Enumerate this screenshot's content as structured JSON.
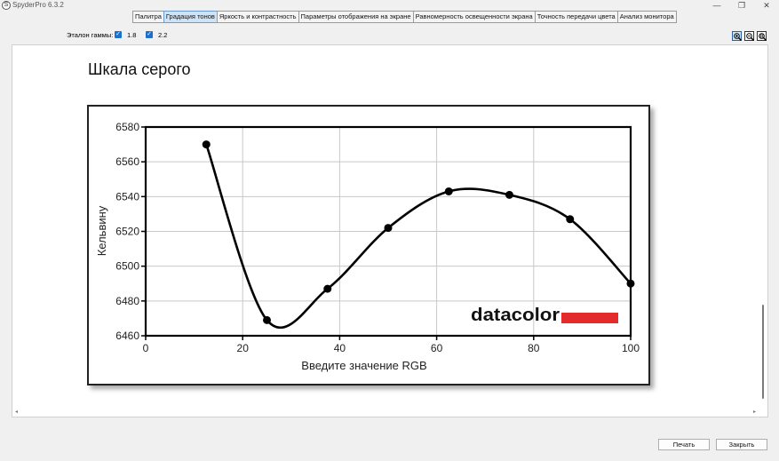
{
  "app": {
    "title": "SpyderPro 6.3.2",
    "icon_glyph": "S"
  },
  "window_controls": {
    "minimize": "—",
    "maximize": "❐",
    "close": "✕"
  },
  "tabs": [
    {
      "label": "Палитра",
      "active": false
    },
    {
      "label": "Градация тонов",
      "active": true
    },
    {
      "label": "Яркость и контрастность",
      "active": false
    },
    {
      "label": "Параметры отображения на экране",
      "active": false
    },
    {
      "label": "Равномерность освещенности экрана",
      "active": false
    },
    {
      "label": "Точность передачи цвета",
      "active": false
    },
    {
      "label": "Анализ монитора",
      "active": false
    }
  ],
  "gamma": {
    "label": "Эталон гаммы:",
    "options": [
      {
        "label": "1.8",
        "checked": true
      },
      {
        "label": "2.2",
        "checked": true
      }
    ]
  },
  "zoom_icons": [
    "zoom-in-icon",
    "zoom-out-icon",
    "zoom-fit-icon"
  ],
  "page": {
    "title": "Шкала серого"
  },
  "chart_data": {
    "type": "line",
    "xlabel": "Введите значение RGB",
    "ylabel": "Кельвину",
    "xlim": [
      0,
      100
    ],
    "ylim": [
      6460,
      6580
    ],
    "x_ticks": [
      0,
      20,
      40,
      60,
      80,
      100
    ],
    "y_ticks": [
      6460,
      6480,
      6500,
      6520,
      6540,
      6560,
      6580
    ],
    "grid": true,
    "series": [
      {
        "x": [
          12.5,
          25,
          37.5,
          50,
          62.5,
          75,
          87.5,
          100
        ],
        "y": [
          6570,
          6469,
          6487,
          6522,
          6543,
          6541,
          6527,
          6490
        ]
      }
    ],
    "logo": "datacolor",
    "colors": {
      "line": "#000000",
      "grid": "#c8c8c8",
      "logo_bar": "#e32b2b"
    }
  },
  "buttons": {
    "print": "Печать",
    "close": "Закрыть"
  },
  "scroll": {
    "left_arrow": "◂",
    "right_arrow": "▸"
  }
}
